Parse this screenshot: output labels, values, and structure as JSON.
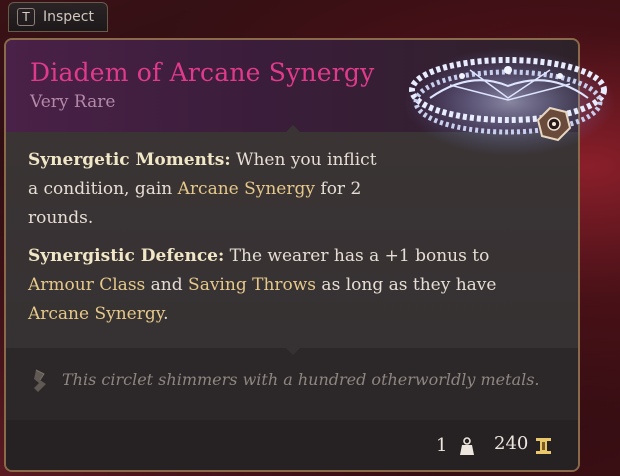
{
  "inspect": {
    "key": "T",
    "label": "Inspect"
  },
  "item": {
    "name": "Diadem of Arcane Synergy",
    "rarity": "Very Rare"
  },
  "properties": [
    {
      "title": "Synergetic Moments:",
      "t1": " When you inflict a condition, gain ",
      "k1": "Arcane Synergy",
      "t2": " for 2 rounds."
    },
    {
      "title": "Synergistic Defence:",
      "t1": " The wearer has a +1 bonus to ",
      "k1": "Armour Class",
      "t2": " and ",
      "k2": "Saving Throws",
      "t3": " as long as they have ",
      "k3": "Arcane Synergy",
      "t4": "."
    }
  ],
  "flavor": "This circlet shimmers with a hundred otherworldly metals.",
  "stats": {
    "weight": "1",
    "price": "240"
  },
  "colors": {
    "title": "#e03a8c",
    "rarity": "#b48aa8",
    "keyword": "#e6c98a",
    "border": "#8a6a4a"
  },
  "icons": {
    "weight": "weight-icon",
    "price": "gold-coin-icon",
    "flavor": "scroll-quill-icon"
  }
}
